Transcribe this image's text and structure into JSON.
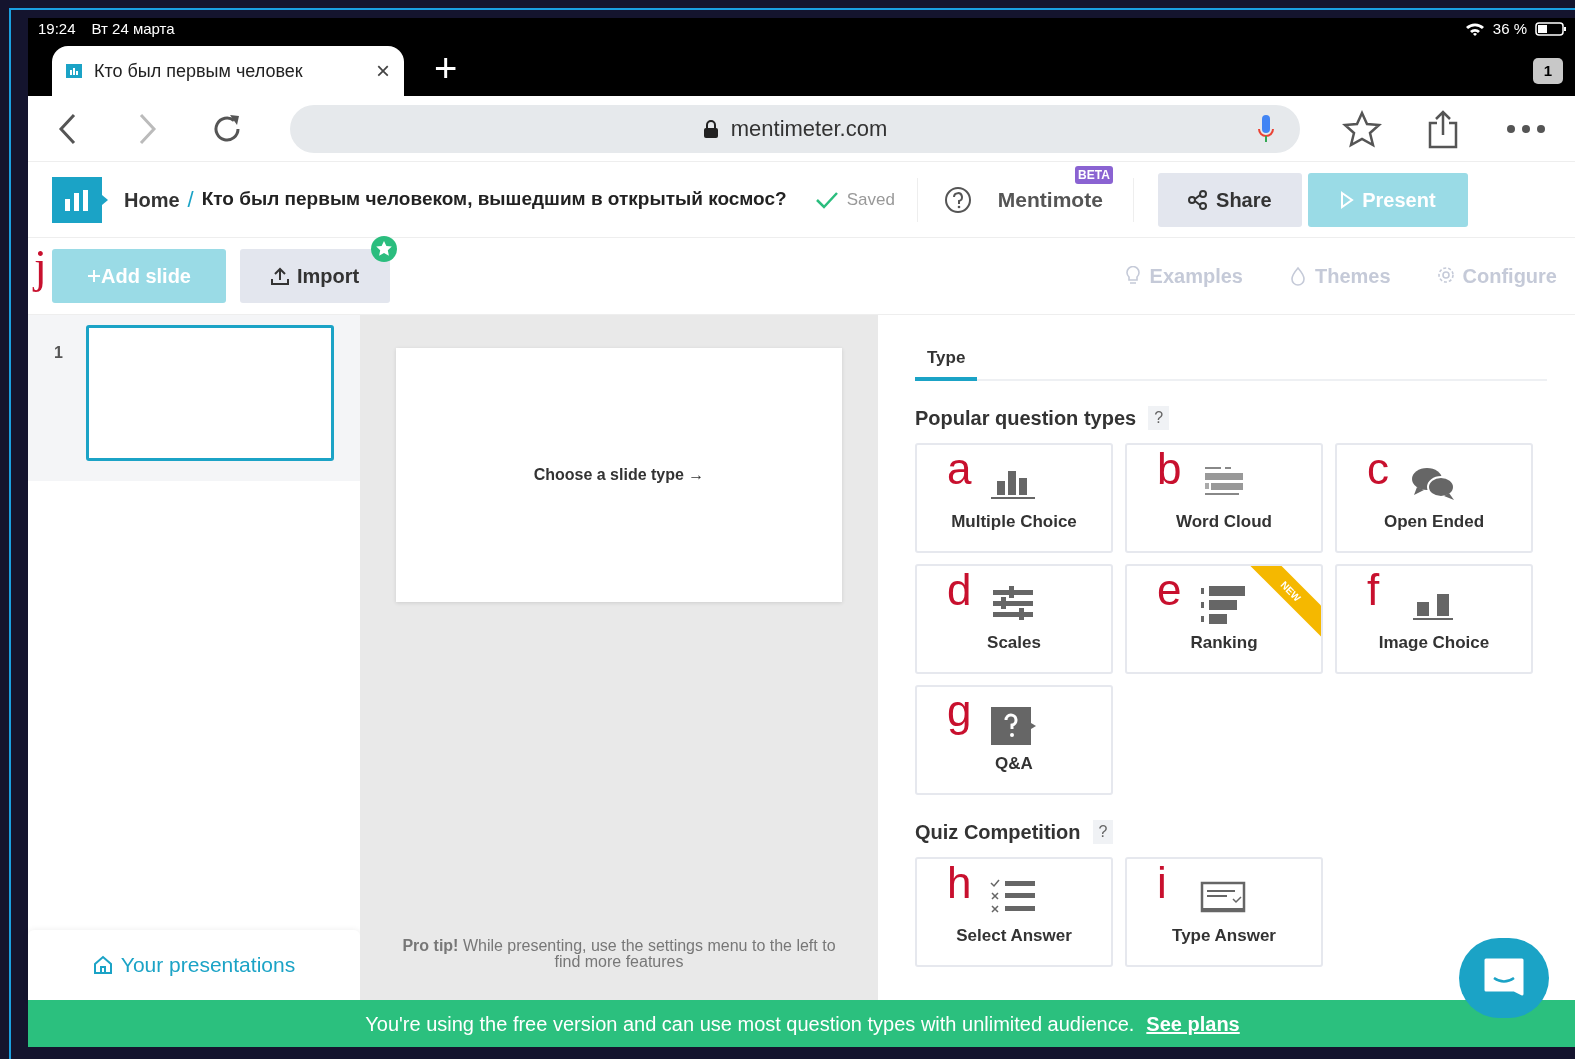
{
  "status_bar": {
    "time": "19:24",
    "date": "Вт 24 марта",
    "battery": "36 %"
  },
  "browser": {
    "tab": {
      "title": "Кто был первым человек",
      "close": "×"
    },
    "new_tab": "+",
    "tab_count": "1",
    "url": "mentimeter.com"
  },
  "header": {
    "home": "Home",
    "separator": "/",
    "title": "Кто был первым человеком, вышедшим в открытый космос?",
    "saved": "Saved",
    "mentimote": "Mentimote",
    "beta": "BETA",
    "share": "Share",
    "present": "Present"
  },
  "toolbar": {
    "add_slide": "Add slide",
    "add_marker": "j",
    "import": "Import",
    "links": [
      {
        "label": "Examples",
        "kind": "bulb"
      },
      {
        "label": "Themes",
        "kind": "drop"
      },
      {
        "label": "Configure",
        "kind": "gear"
      }
    ]
  },
  "slides": [
    {
      "number": "1",
      "selected": true
    }
  ],
  "your_presentations": "Your presentations",
  "canvas": {
    "prompt": "Choose a slide type →",
    "tip": "**Pro tip!** While presenting, use the settings menu to the left to find more features"
  },
  "panel": {
    "tabs": [
      {
        "label": "Type",
        "selected": true
      }
    ],
    "sections": [
      {
        "title": "Popular question types",
        "help": "?",
        "types": [
          {
            "marker": "a",
            "label": "Multiple Choice",
            "kind": "bars"
          },
          {
            "marker": "b",
            "label": "Word Cloud",
            "kind": "cloud"
          },
          {
            "marker": "c",
            "label": "Open Ended",
            "kind": "speech"
          },
          {
            "marker": "d",
            "label": "Scales",
            "kind": "sliders"
          },
          {
            "marker": "e",
            "label": "Ranking",
            "kind": "ranking",
            "badge": "NEW"
          },
          {
            "marker": "f",
            "label": "Image Choice",
            "kind": "images"
          },
          {
            "marker": "g",
            "label": "Q&A",
            "kind": "qa"
          }
        ]
      },
      {
        "title": "Quiz Competition",
        "help": "?",
        "types": [
          {
            "marker": "h",
            "label": "Select Answer",
            "kind": "select"
          },
          {
            "marker": "i",
            "label": "Type Answer",
            "kind": "typed"
          }
        ]
      }
    ]
  },
  "banner": {
    "text": "You're using the free version and can use most question types with unlimited audience.",
    "link": "See plans"
  }
}
